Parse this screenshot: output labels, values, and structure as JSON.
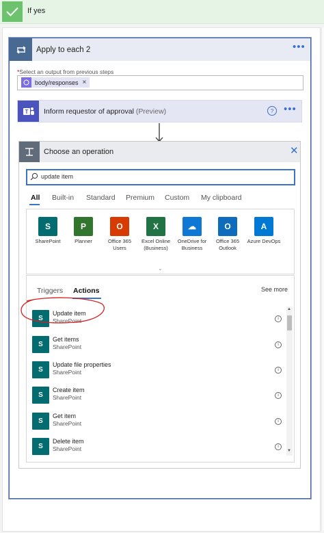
{
  "condition": {
    "label": "If yes"
  },
  "apply_to_each": {
    "title": "Apply to each 2",
    "menu_icon": "ellipsis-icon",
    "select_label": "Select an output from previous steps",
    "required_marker": "*",
    "token": "body/responses",
    "token_remove": "×"
  },
  "inform_step": {
    "title": "Inform requestor of approval",
    "preview": "(Preview)",
    "help": "?"
  },
  "choose_operation": {
    "title": "Choose an operation",
    "search_value": "update item",
    "tabs": [
      "All",
      "Built-in",
      "Standard",
      "Premium",
      "Custom",
      "My clipboard"
    ],
    "connectors": [
      {
        "label": "SharePoint",
        "color": "#036c70",
        "glyph": "S"
      },
      {
        "label": "Planner",
        "color": "#31752f",
        "glyph": "P"
      },
      {
        "label": "Office 365 Users",
        "color": "#d83b01",
        "glyph": "O"
      },
      {
        "label": "Excel Online (Business)",
        "color": "#217346",
        "glyph": "X"
      },
      {
        "label": "OneDrive for Business",
        "color": "#0f78d4",
        "glyph": "☁"
      },
      {
        "label": "Office 365 Outlook",
        "color": "#0f6cbd",
        "glyph": "O"
      },
      {
        "label": "Azure DevOps",
        "color": "#0078d4",
        "glyph": "A"
      }
    ],
    "expand_glyph": "⌄",
    "subtabs": {
      "triggers": "Triggers",
      "actions": "Actions"
    },
    "see_more": "See more",
    "actions": [
      {
        "name": "Update item",
        "connector": "SharePoint"
      },
      {
        "name": "Get items",
        "connector": "SharePoint"
      },
      {
        "name": "Update file properties",
        "connector": "SharePoint"
      },
      {
        "name": "Create item",
        "connector": "SharePoint"
      },
      {
        "name": "Get item",
        "connector": "SharePoint"
      },
      {
        "name": "Delete item",
        "connector": "SharePoint"
      }
    ],
    "info_glyph": "i"
  },
  "colors": {
    "accent": "#3a74c8",
    "sharepoint": "#036c70",
    "teams": "#4b53bc",
    "condition_green": "#6dc36d",
    "highlight_circle": "#d42020"
  }
}
